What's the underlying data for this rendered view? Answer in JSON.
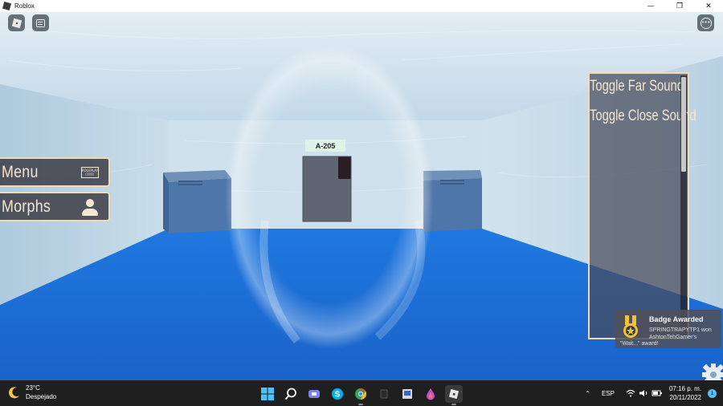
{
  "window": {
    "title": "Roblox",
    "controls": {
      "minimize": "—",
      "maximize": "❐",
      "close": "✕"
    }
  },
  "scene": {
    "door_sign": "A-205",
    "colors": {
      "floor": "#1f6fd6",
      "walls": "#c7dcea",
      "ceiling": "#dbe9f2"
    }
  },
  "game_ui": {
    "topbar_icons": [
      "roblox-menu-icon",
      "chat-icon",
      "more-options-icon"
    ],
    "side_buttons": [
      {
        "label": "Menu",
        "icon": "robux-shop-icon",
        "icon_text": "ROLEPLAY\n▯▯▯▯▯"
      },
      {
        "label": "Morphs",
        "icon": "person-icon"
      }
    ],
    "sound_panel": {
      "items": [
        "Toggle Far Sound",
        "Toggle Close Sound"
      ]
    },
    "badge": {
      "title": "Badge Awarded",
      "text": "SPRINGTRAPYTP1 won AshtonTehGamer's",
      "text2": "\"Wait...\" award!"
    }
  },
  "taskbar": {
    "weather": {
      "temp": "23°C",
      "condition": "Despejado"
    },
    "apps": [
      "windows-start-icon",
      "search-icon",
      "teams-icon",
      "skype-icon",
      "chrome-icon",
      "camera-icon",
      "photo-viewer-icon",
      "paint-drop-icon",
      "roblox-icon"
    ],
    "tray": {
      "chevron": "⌃",
      "language": "ESP"
    },
    "clock": {
      "time": "07:16 p. m.",
      "date": "20/11/2022"
    },
    "notification_count": "1"
  }
}
